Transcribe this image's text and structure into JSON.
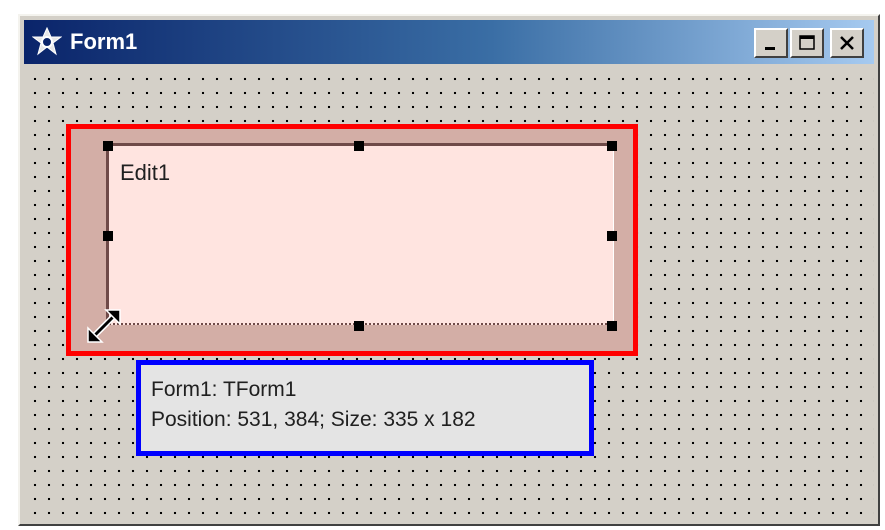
{
  "window": {
    "title": "Form1",
    "icon": "delphi-app-icon",
    "buttons": [
      "minimize-icon",
      "maximize-icon",
      "close-icon"
    ]
  },
  "edit": {
    "text": "Edit1"
  },
  "hint": {
    "line1": "Form1: TForm1",
    "line2": "Position: 531, 384; Size: 335 x 182"
  },
  "colors": {
    "titlebar_start": "#0a246a",
    "titlebar_end": "#a6caf0",
    "selection_outline": "#ff0000",
    "hint_outline": "#0000ff",
    "edit_fill": "#ffe4e0"
  }
}
